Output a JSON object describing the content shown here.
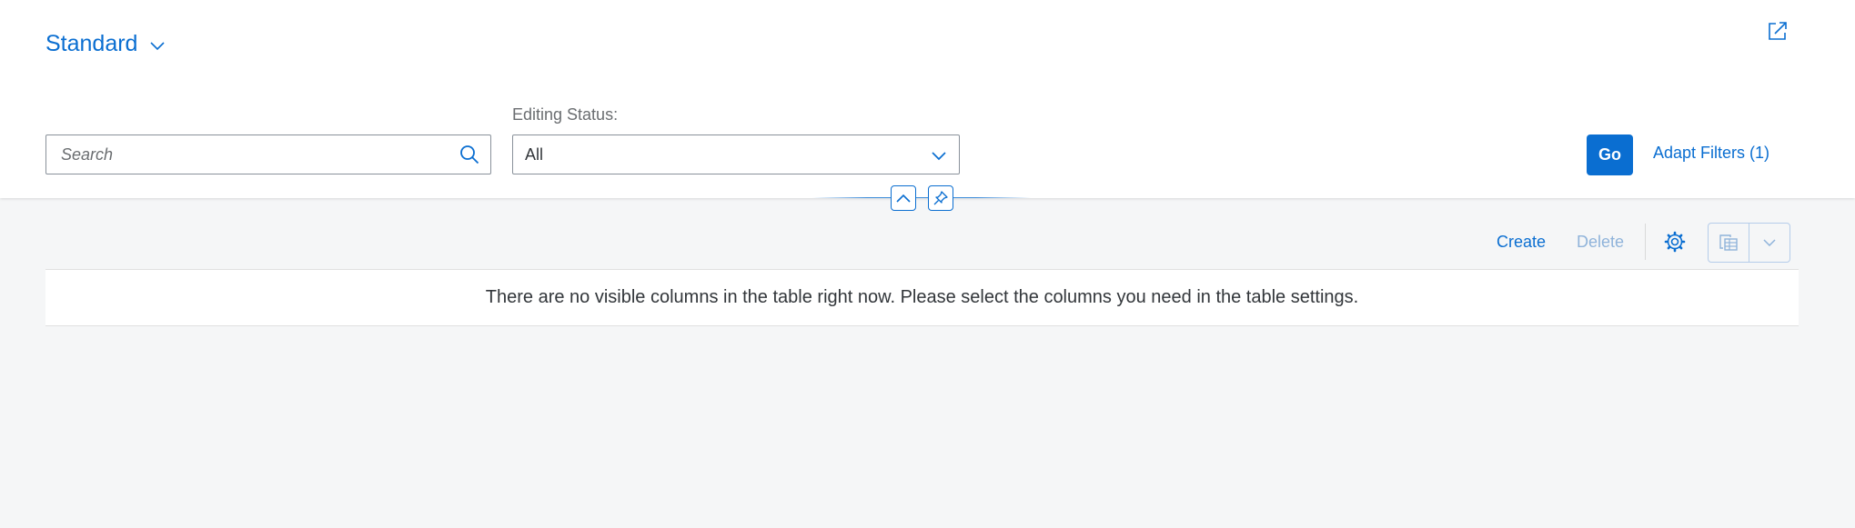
{
  "header": {
    "variant_title": "Standard",
    "search": {
      "placeholder": "Search",
      "value": ""
    },
    "filters": [
      {
        "label": "Editing Status:",
        "value": "All"
      }
    ],
    "go_label": "Go",
    "adapt_filters_label": "Adapt Filters (1)"
  },
  "toolbar": {
    "create_label": "Create",
    "delete_label": "Delete"
  },
  "table": {
    "no_data_text": "There are no visible columns in the table right now. Please select the columns you need in the table settings."
  },
  "icons": {
    "variant": "chevron-down-icon",
    "share": "share-icon",
    "search": "search-icon",
    "select": "chevron-down-icon",
    "collapse": "chevron-up-icon",
    "pin": "pin-icon",
    "settings": "gear-icon",
    "export": "export-spreadsheet-icon",
    "export_menu": "chevron-down-icon"
  },
  "colors": {
    "accent": "#0a6ed1",
    "disabled": "#8fb3da",
    "background": "#f5f6f7"
  }
}
